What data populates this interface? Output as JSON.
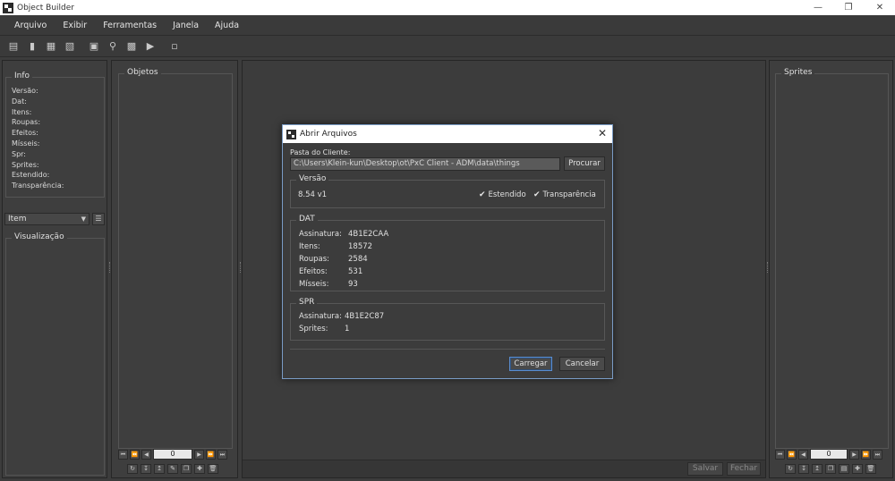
{
  "window": {
    "title": "Object Builder"
  },
  "menu": [
    "Arquivo",
    "Exibir",
    "Ferramentas",
    "Janela",
    "Ajuda"
  ],
  "left": {
    "info_title": "Info",
    "info_lines": [
      "Versão:",
      "Dat:",
      "Itens:",
      "Roupas:",
      "Efeitos:",
      "Mísseis:",
      "Spr:",
      "Sprites:",
      "Estendido:",
      "Transparência:"
    ],
    "type_select": "Item",
    "preview_title": "Visualização"
  },
  "objects": {
    "title": "Objetos",
    "page": "0"
  },
  "sprites": {
    "title": "Sprites",
    "page": "0"
  },
  "bottom": {
    "save": "Salvar",
    "close": "Fechar"
  },
  "dialog": {
    "title": "Abrir Arquivos",
    "client_folder_label": "Pasta do Cliente:",
    "client_folder_value": "C:\\Users\\Klein-kun\\Desktop\\ot\\PxC Client - ADM\\data\\things",
    "browse_button": "Procurar",
    "version_title": "Versão",
    "version_value": "8.54 v1",
    "extended_label": "Estendido",
    "extended_checked": true,
    "transparency_label": "Transparência",
    "transparency_checked": true,
    "dat_title": "DAT",
    "dat": [
      {
        "label": "Assinatura:",
        "value": "4B1E2CAA"
      },
      {
        "label": "Itens:",
        "value": "18572"
      },
      {
        "label": "Roupas:",
        "value": "2584"
      },
      {
        "label": "Efeitos:",
        "value": "531"
      },
      {
        "label": "Mísseis:",
        "value": "93"
      }
    ],
    "spr_title": "SPR",
    "spr": [
      {
        "label": "Assinatura:",
        "value": "4B1E2C87"
      },
      {
        "label": "Sprites:",
        "value": "1"
      }
    ],
    "load_button": "Carregar",
    "cancel_button": "Cancelar"
  }
}
